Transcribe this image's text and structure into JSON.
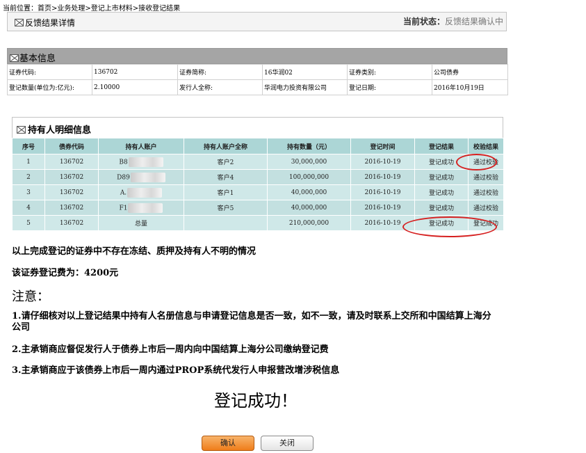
{
  "breadcrumb": "当前位置：首页>业务处理>登记上市材料>接收登记结果",
  "detail_header": {
    "title": "反馈结果详情",
    "status_label": "当前状态：",
    "status_value": "反馈结果确认中"
  },
  "basic_info": {
    "title": "基本信息",
    "rows": [
      [
        "证券代码:",
        "136702",
        "证券简称:",
        "16华润02",
        "证券类别:",
        "公司债券"
      ],
      [
        "登记数量(单位为:亿元):",
        "2.10000",
        "发行人全称:",
        "华润电力投资有限公司",
        "登记日期:",
        "2016年10月19日"
      ]
    ]
  },
  "holders": {
    "title": "持有人明细信息",
    "columns": [
      "序号",
      "债券代码",
      "持有人账户",
      "持有人账户全称",
      "持有数量（元）",
      "登记时间",
      "登记结果",
      "校验结果"
    ],
    "rows": [
      {
        "no": "1",
        "code": "136702",
        "account": "B8",
        "name": "客户2",
        "amount": "30,000,000",
        "date": "2016-10-19",
        "result": "登记成功",
        "check": "通过校验"
      },
      {
        "no": "2",
        "code": "136702",
        "account": "D89",
        "name": "客户4",
        "amount": "100,000,000",
        "date": "2016-10-19",
        "result": "登记成功",
        "check": "通过校验"
      },
      {
        "no": "3",
        "code": "136702",
        "account": "A.",
        "name": "客户1",
        "amount": "40,000,000",
        "date": "2016-10-19",
        "result": "登记成功",
        "check": "通过校验"
      },
      {
        "no": "4",
        "code": "136702",
        "account": "F1",
        "name": "客户5",
        "amount": "40,000,000",
        "date": "2016-10-19",
        "result": "登记成功",
        "check": "通过校验"
      },
      {
        "no": "5",
        "code": "136702",
        "account": "总量",
        "name": "",
        "amount": "210,000,000",
        "date": "2016-10-19",
        "result": "登记成功",
        "check": "登记成功"
      }
    ]
  },
  "statement": "以上完成登记的证券中不存在冻结、质押及持有人不明的情况",
  "fee": "该证券登记费为：4200元",
  "notice": {
    "title": "注意：",
    "items": [
      "1.请仔细核对以上登记结果中持有人名册信息与申请登记信息是否一致，如不一致，请及时联系上交所和中国结算上海分公司",
      "2.主承销商应督促发行人于债券上市后一周内向中国结算上海分公司缴纳登记费",
      "3.主承销商应于该债券上市后一周内通过PROP系统代发行人申报营改增涉税信息"
    ]
  },
  "success_message": "登记成功！",
  "buttons": {
    "confirm": "确认",
    "close": "关闭"
  },
  "colors": {
    "table_header": "#acd6d6",
    "table_row": "#cfe8e8",
    "section_header": "#a5a5a5",
    "confirm_button": "#ef7d1a",
    "annotation": "#d62020"
  }
}
